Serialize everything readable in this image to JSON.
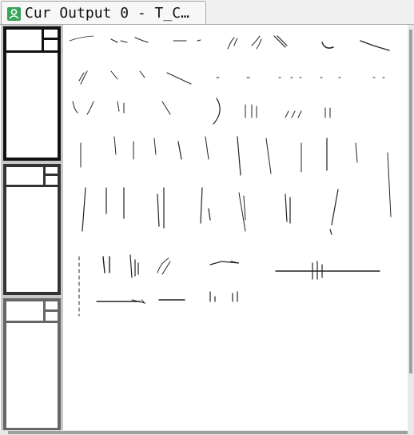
{
  "tab": {
    "title": "Cur Output 0 - T_C…",
    "icon": "person-icon",
    "icon_color": "#3aa55a"
  },
  "thumbnails": [
    {
      "name": "thumbnail-1",
      "border_color": "#111111",
      "selected": true
    },
    {
      "name": "thumbnail-2",
      "border_color": "#333333",
      "selected": false
    },
    {
      "name": "thumbnail-3",
      "border_color": "#666666",
      "selected": false
    }
  ],
  "canvas": {
    "background": "#ffffff",
    "stroke_color": "#222222"
  }
}
